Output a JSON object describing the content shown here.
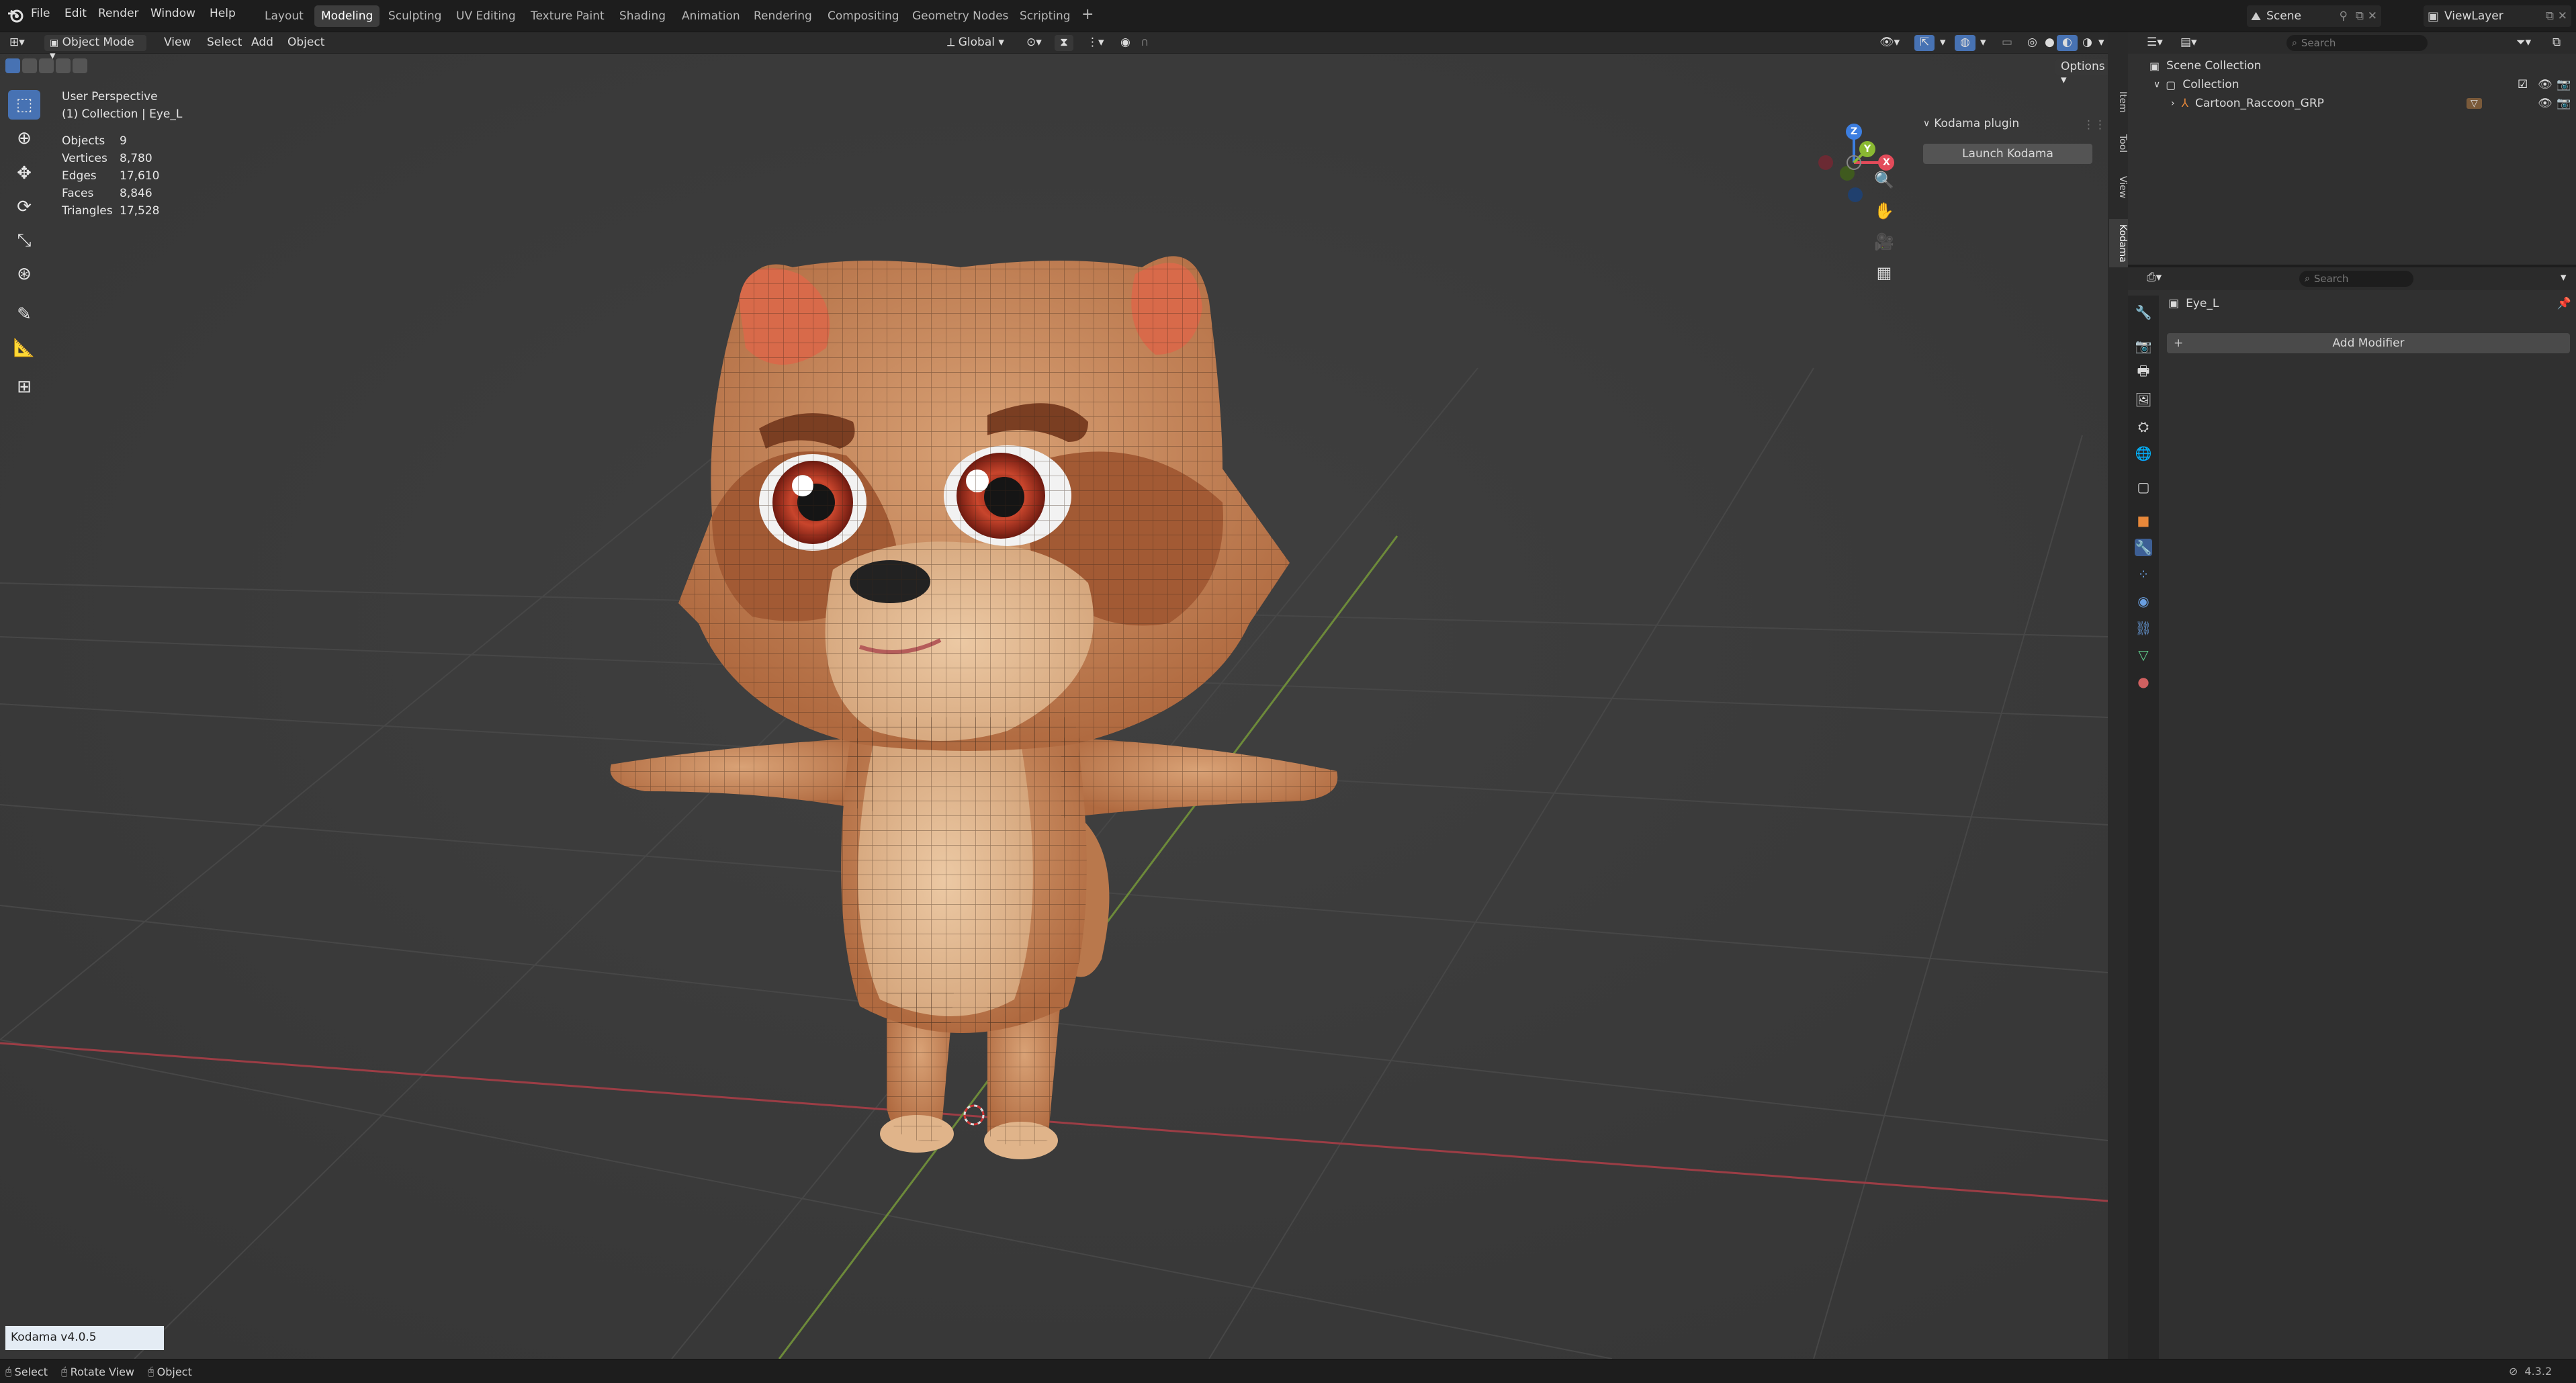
{
  "menu": {
    "file": "File",
    "edit": "Edit",
    "render": "Render",
    "window": "Window",
    "help": "Help"
  },
  "workspaces": [
    "Layout",
    "Modeling",
    "Sculpting",
    "UV Editing",
    "Texture Paint",
    "Shading",
    "Animation",
    "Rendering",
    "Compositing",
    "Geometry Nodes",
    "Scripting"
  ],
  "workspace_add": "+",
  "top_right": {
    "scene": "Scene",
    "view_layer": "ViewLayer"
  },
  "viewport_header": {
    "mode": "Object Mode",
    "view": "View",
    "select": "Select",
    "add": "Add",
    "object": "Object",
    "transform_orientation": "Global",
    "options": "Options"
  },
  "overlay_info": {
    "perspective": "User Perspective",
    "collection": "(1) Collection | Eye_L",
    "stats": [
      {
        "label": "Objects",
        "value": "9"
      },
      {
        "label": "Vertices",
        "value": "8,780"
      },
      {
        "label": "Edges",
        "value": "17,610"
      },
      {
        "label": "Faces",
        "value": "8,846"
      },
      {
        "label": "Triangles",
        "value": "17,528"
      }
    ]
  },
  "gizmo": {
    "x": "X",
    "y": "Y",
    "z": "Z"
  },
  "npanel": {
    "panel_title": "Kodama plugin",
    "launch_button": "Launch Kodama",
    "tabs": [
      "Item",
      "Tool",
      "View",
      "Kodama"
    ]
  },
  "kodama_version": "Kodama v4.0.5",
  "outliner": {
    "search_placeholder": "Search",
    "scene_collection": "Scene Collection",
    "collection": "Collection",
    "child": "Cartoon_Raccoon_GRP"
  },
  "properties": {
    "search_placeholder": "Search",
    "object_name": "Eye_L",
    "add_modifier": "Add Modifier"
  },
  "statusbar": {
    "select": "Select",
    "rotate_view": "Rotate View",
    "object": "Object",
    "version": "4.3.2"
  },
  "colors": {
    "accent": "#4772b3",
    "x_axis": "#e34b5a",
    "y_axis": "#8ab932",
    "z_axis": "#3c7ee0",
    "viewport_bg": "#3b3b3b"
  }
}
